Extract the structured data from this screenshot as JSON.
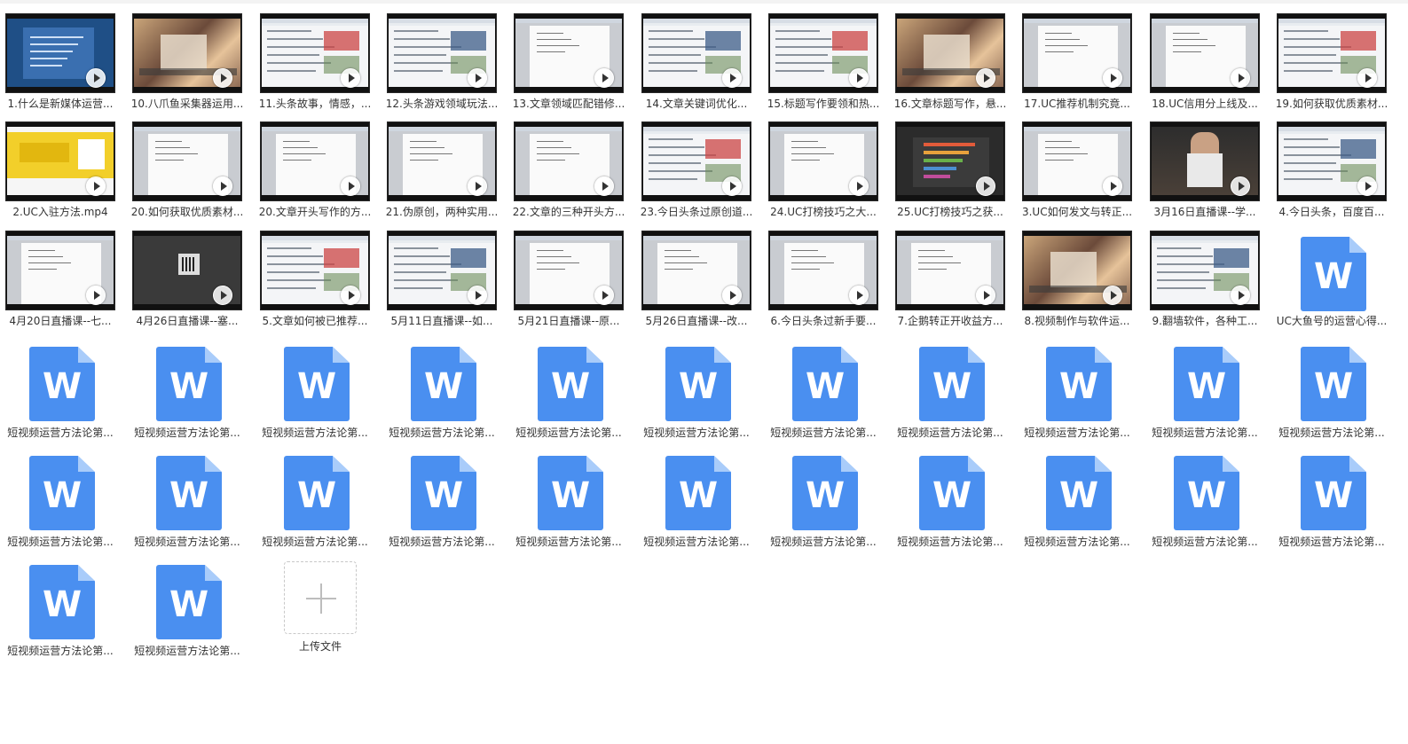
{
  "files": [
    {
      "name": "1.什么是新媒体运营...",
      "type": "video",
      "thumb": "slide"
    },
    {
      "name": "10.八爪鱼采集器运用...",
      "type": "video",
      "thumb": "anime"
    },
    {
      "name": "11.头条故事，情感，...",
      "type": "video",
      "thumb": "web"
    },
    {
      "name": "12.头条游戏领域玩法...",
      "type": "video",
      "thumb": "web"
    },
    {
      "name": "13.文章领域匹配错修...",
      "type": "video",
      "thumb": "doc"
    },
    {
      "name": "14.文章关键词优化...",
      "type": "video",
      "thumb": "web"
    },
    {
      "name": "15.标题写作要领和热...",
      "type": "video",
      "thumb": "web"
    },
    {
      "name": "16.文章标题写作，悬...",
      "type": "video",
      "thumb": "anime"
    },
    {
      "name": "17.UC推荐机制究竟...",
      "type": "video",
      "thumb": "doc"
    },
    {
      "name": "18.UC信用分上线及...",
      "type": "video",
      "thumb": "doc"
    },
    {
      "name": "19.如何获取优质素材...",
      "type": "video",
      "thumb": "web"
    },
    {
      "name": "2.UC入驻方法.mp4",
      "type": "video",
      "thumb": "yellow"
    },
    {
      "name": "20.如何获取优质素材...",
      "type": "video",
      "thumb": "doc"
    },
    {
      "name": "20.文章开头写作的方...",
      "type": "video",
      "thumb": "doc"
    },
    {
      "name": "21.伪原创，两种实用...",
      "type": "video",
      "thumb": "doc"
    },
    {
      "name": "22.文章的三种开头方...",
      "type": "video",
      "thumb": "doc"
    },
    {
      "name": "23.今日头条过原创道...",
      "type": "video",
      "thumb": "web"
    },
    {
      "name": "24.UC打榜技巧之大...",
      "type": "video",
      "thumb": "doc"
    },
    {
      "name": "25.UC打榜技巧之获...",
      "type": "video",
      "thumb": "dark"
    },
    {
      "name": "3.UC如何发文与转正...",
      "type": "video",
      "thumb": "doc"
    },
    {
      "name": "3月16日直播课--学...",
      "type": "video",
      "thumb": "photo"
    },
    {
      "name": "4.今日头条，百度百...",
      "type": "video",
      "thumb": "web"
    },
    {
      "name": "4月20日直播课--七...",
      "type": "video",
      "thumb": "doc"
    },
    {
      "name": "4月26日直播课--塞...",
      "type": "video",
      "thumb": "darkqr"
    },
    {
      "name": "5.文章如何被已推荐...",
      "type": "video",
      "thumb": "web"
    },
    {
      "name": "5月11日直播课--如...",
      "type": "video",
      "thumb": "web"
    },
    {
      "name": "5月21日直播课--原...",
      "type": "video",
      "thumb": "doc"
    },
    {
      "name": "5月26日直播课--改...",
      "type": "video",
      "thumb": "doc"
    },
    {
      "name": "6.今日头条过新手要...",
      "type": "video",
      "thumb": "doc"
    },
    {
      "name": "7.企鹅转正开收益方...",
      "type": "video",
      "thumb": "doc"
    },
    {
      "name": "8.视频制作与软件运...",
      "type": "video",
      "thumb": "anime"
    },
    {
      "name": "9.翻墙软件，各种工...",
      "type": "video",
      "thumb": "web"
    },
    {
      "name": "UC大鱼号的运营心得...",
      "type": "word"
    },
    {
      "name": "短视频运营方法论第...",
      "type": "word"
    },
    {
      "name": "短视频运营方法论第...",
      "type": "word"
    },
    {
      "name": "短视频运营方法论第...",
      "type": "word"
    },
    {
      "name": "短视频运营方法论第...",
      "type": "word"
    },
    {
      "name": "短视频运营方法论第...",
      "type": "word"
    },
    {
      "name": "短视频运营方法论第...",
      "type": "word"
    },
    {
      "name": "短视频运营方法论第...",
      "type": "word"
    },
    {
      "name": "短视频运营方法论第...",
      "type": "word"
    },
    {
      "name": "短视频运营方法论第...",
      "type": "word"
    },
    {
      "name": "短视频运营方法论第...",
      "type": "word"
    },
    {
      "name": "短视频运营方法论第...",
      "type": "word"
    },
    {
      "name": "短视频运营方法论第...",
      "type": "word"
    },
    {
      "name": "短视频运营方法论第...",
      "type": "word"
    },
    {
      "name": "短视频运营方法论第...",
      "type": "word"
    },
    {
      "name": "短视频运营方法论第...",
      "type": "word"
    },
    {
      "name": "短视频运营方法论第...",
      "type": "word"
    },
    {
      "name": "短视频运营方法论第...",
      "type": "word"
    },
    {
      "name": "短视频运营方法论第...",
      "type": "word"
    },
    {
      "name": "短视频运营方法论第...",
      "type": "word"
    },
    {
      "name": "短视频运营方法论第...",
      "type": "word"
    },
    {
      "name": "短视频运营方法论第...",
      "type": "word"
    },
    {
      "name": "短视频运营方法论第...",
      "type": "word"
    },
    {
      "name": "短视频运营方法论第...",
      "type": "word"
    },
    {
      "name": "短视频运营方法论第...",
      "type": "word"
    }
  ],
  "word_icon_letter": "W",
  "upload": {
    "label": "上传文件",
    "icon": "plus-icon"
  },
  "colors": {
    "word_blue": "#4a8ff0",
    "word_fold": "#a9ccfa",
    "background": "#ffffff"
  }
}
